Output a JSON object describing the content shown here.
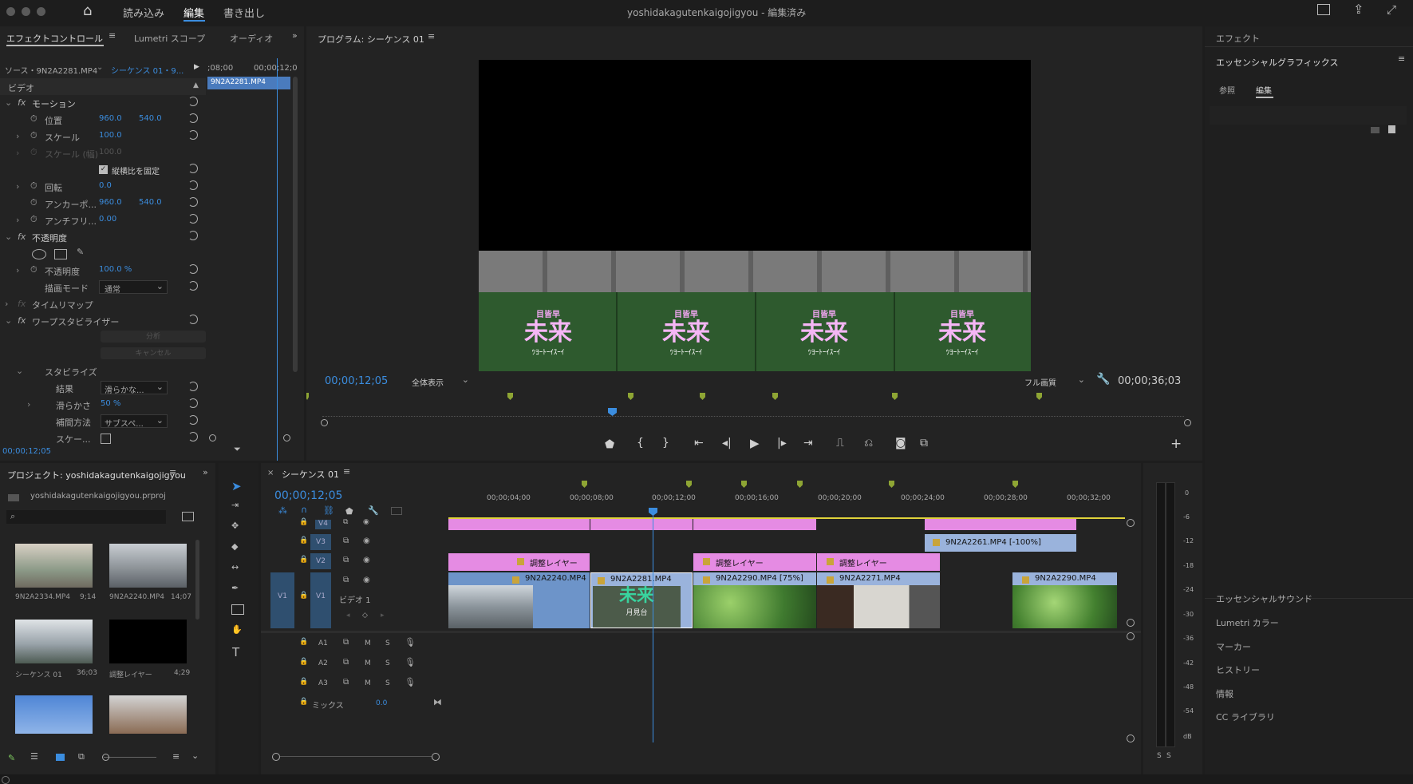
{
  "topbar": {
    "nav": [
      "読み込み",
      "編集",
      "書き出し"
    ],
    "title": "yoshidakagutenkaigojigyou - 編集済み"
  },
  "effect_controls": {
    "tabs": [
      "エフェクトコントロール",
      "Lumetri スコープ",
      "オーディオ"
    ],
    "source_label": "ソース・9N2A2281.MP4",
    "sequence_label": "シーケンス 01・9...",
    "time_a": ";08;00",
    "time_b": "00;00;12;0",
    "clip_name": "9N2A2281.MP4",
    "section_video": "ビデオ",
    "motion": "モーション",
    "position_label": "位置",
    "position_x": "960.0",
    "position_y": "540.0",
    "scale_label": "スケール",
    "scale_value": "100.0",
    "scale_w_label": "スケール (幅)",
    "scale_w_value": "100.0",
    "uniform_label": "縦横比を固定",
    "rotation_label": "回転",
    "rotation_value": "0.0",
    "anchor_label": "アンカーポ...",
    "anchor_x": "960.0",
    "anchor_y": "540.0",
    "antiflicker_label": "アンチフリ...",
    "antiflicker_value": "0.00",
    "opacity_section": "不透明度",
    "opacity_label": "不透明度",
    "opacity_value": "100.0 %",
    "blend_label": "描画モード",
    "blend_value": "通常",
    "time_remap": "タイムリマップ",
    "warp": "ワープスタビライザー",
    "analyze_btn": "分析",
    "cancel_btn": "キャンセル",
    "stabilize": "スタビライズ",
    "result_label": "結果",
    "result_value": "滑らかな...",
    "smooth_label": "滑らかさ",
    "smooth_value": "50 %",
    "method_label": "補間方法",
    "method_value": "サブスペ...",
    "scale_last_label": "スケー...",
    "timecode": "00;00;12;05"
  },
  "program": {
    "title": "プログラム: シーケンス 01",
    "timecode": "00;00;12;05",
    "fit": "全体表示",
    "quality": "フル画質",
    "duration": "00;00;36;03",
    "sign_top": "目皆早",
    "sign_main": "未来",
    "sign_bottom": "ﾂﾖｰﾄｰｲｽｰｲ"
  },
  "project": {
    "title": "プロジェクト: yoshidakagutenkaigojigyou",
    "file": "yoshidakagutenkaigojigyou.prproj",
    "items": [
      {
        "name": "9N2A2334.MP4",
        "dur": "9;14"
      },
      {
        "name": "9N2A2240.MP4",
        "dur": "14;07"
      },
      {
        "name": "シーケンス 01",
        "dur": "36;03"
      },
      {
        "name": "調整レイヤー",
        "dur": "4;29"
      }
    ]
  },
  "timeline": {
    "tab": "シーケンス 01",
    "timecode": "00;00;12;05",
    "ruler": [
      "00;00;04;00",
      "00;00;08;00",
      "00;00;12;00",
      "00;00;16;00",
      "00;00;20;00",
      "00;00;24;00",
      "00;00;28;00",
      "00;00;32;00"
    ],
    "tracks_video": [
      "V4",
      "V3",
      "V2",
      "V1"
    ],
    "v1_src": "V1",
    "video_label": "ビデオ 1",
    "tracks_audio": [
      "A1",
      "A2",
      "A3"
    ],
    "mix_label": "ミックス",
    "mix_value": "0.0",
    "clips": {
      "v3": "9N2A2261.MP4 [-100%]",
      "adj1": "調整レイヤー",
      "adj2": "調整レイヤー",
      "adj3": "調整レイヤー",
      "c1": "9N2A2240.MP4",
      "c2": "9N2A2281.MP4",
      "c3": "9N2A2290.MP4 [75%]",
      "c4": "9N2A2271.MP4",
      "c5": "9N2A2290.MP4"
    },
    "thumb_sign": "未来",
    "thumb_sub": "月見台",
    "m_label": "M",
    "s_label": "S",
    "track_num": "1"
  },
  "meter": {
    "labels": [
      "0",
      "-6",
      "-12",
      "-18",
      "-24",
      "-30",
      "-36",
      "-42",
      "-48",
      "-54",
      "dB"
    ],
    "solo": "S"
  },
  "right": {
    "effects": "エフェクト",
    "essential_graphics": "エッセンシャルグラフィックス",
    "tabs": [
      "参照",
      "編集"
    ],
    "items": [
      "エッセンシャルサウンド",
      "Lumetri カラー",
      "マーカー",
      "ヒストリー",
      "情報",
      "CC ライブラリ"
    ]
  }
}
